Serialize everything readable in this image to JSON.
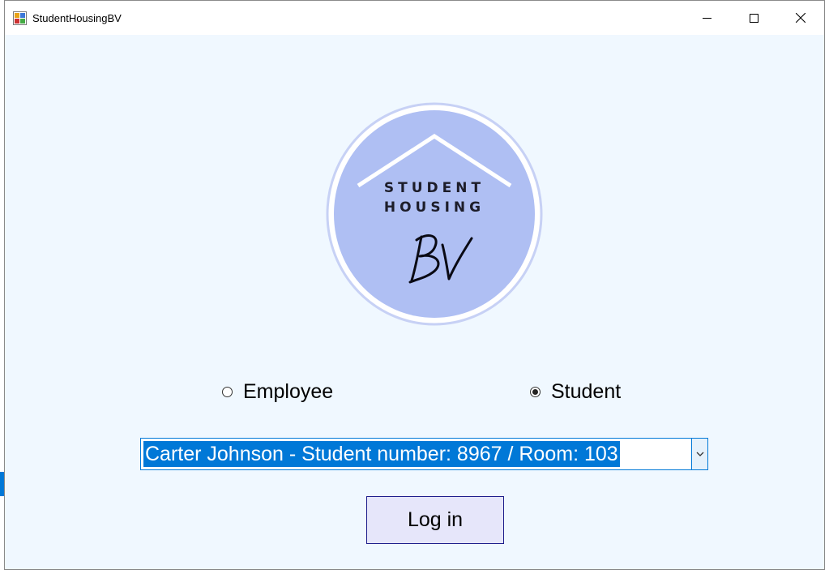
{
  "window": {
    "title": "StudentHousingBV"
  },
  "logo": {
    "line1": "STUDENT",
    "line2": "HOUSING",
    "mark": "BV",
    "circle_color": "#afbff3",
    "ring_color": "#c7d1f5"
  },
  "role": {
    "employee_label": "Employee",
    "student_label": "Student",
    "selected": "Student"
  },
  "user_select": {
    "selected_value": "Carter Johnson - Student number: 8967 / Room: 103"
  },
  "login": {
    "label": "Log in"
  },
  "colors": {
    "background": "#f0f8ff",
    "accent": "#0078d7",
    "button_bg": "#e6e6fa",
    "button_border": "#1a1a8a"
  },
  "icons": {
    "app": "app-icon",
    "minimize": "minimize-icon",
    "maximize": "maximize-icon",
    "close": "close-icon",
    "dropdown": "chevron-down-icon"
  }
}
